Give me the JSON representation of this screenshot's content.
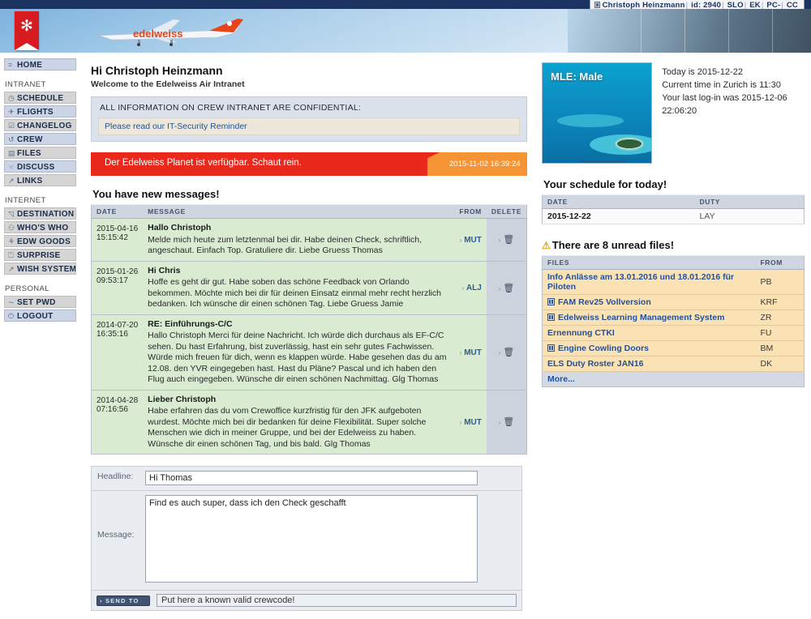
{
  "topbar": {
    "user_icon": "window-icon",
    "user_name": "Christoph Heinzmann",
    "id_label": "id: 2940",
    "slo": "SLO",
    "ek": "EK",
    "pc": "PC-",
    "cc": "CC",
    "separator": "|"
  },
  "header": {
    "logo_alt": "edelweiss-logo",
    "plane_alt": "edelweiss-aircraft"
  },
  "nav": {
    "home": {
      "label": "HOME",
      "icon": "grid-icon"
    },
    "sections": [
      {
        "title": "INTRANET",
        "items": [
          {
            "label": "SCHEDULE",
            "icon": "clock-icon",
            "glyph": "◷",
            "style": "gray"
          },
          {
            "label": "FLIGHTS",
            "icon": "plane-icon",
            "glyph": "✈",
            "style": "blue"
          },
          {
            "label": "CHANGELOG",
            "icon": "checkbox-icon",
            "glyph": "☑",
            "style": "gray"
          },
          {
            "label": "CREW",
            "icon": "refresh-icon",
            "glyph": "↺",
            "style": "blue"
          },
          {
            "label": "FILES",
            "icon": "document-icon",
            "glyph": "🗎",
            "style": "gray"
          },
          {
            "label": "DISCUSS",
            "icon": "speech-icon",
            "glyph": "♉",
            "style": "blue"
          },
          {
            "label": "LINKS",
            "icon": "external-link-icon",
            "glyph": "↗",
            "style": "gray"
          }
        ]
      },
      {
        "title": "INTERNET",
        "items": [
          {
            "label": "DESTINATION",
            "icon": "mountain-icon",
            "glyph": "⌂",
            "style": "gray"
          },
          {
            "label": "WHO'S WHO",
            "icon": "people-icon",
            "glyph": "品",
            "style": "gray"
          },
          {
            "label": "EDW GOODS",
            "icon": "person-icon",
            "glyph": "ጸ",
            "style": "gray"
          },
          {
            "label": "SURPRISE",
            "icon": "gift-icon",
            "glyph": "⊽",
            "style": "gray"
          },
          {
            "label": "WISH SYSTEM",
            "icon": "external-link-icon",
            "glyph": "↗",
            "style": "gray"
          }
        ]
      },
      {
        "title": "PERSONAL",
        "items": [
          {
            "label": "SET PWD",
            "icon": "key-icon",
            "glyph": "∼",
            "style": "gray"
          },
          {
            "label": "LOGOUT",
            "icon": "power-icon",
            "glyph": "⏻",
            "style": "blue"
          }
        ]
      }
    ]
  },
  "main": {
    "greeting": "Hi Christoph Heinzmann",
    "subgreeting": "Welcome to the Edelweiss Air Intranet",
    "confidential": {
      "title": "ALL INFORMATION ON CREW INTRANET ARE CONFIDENTIAL:",
      "link": "Please read our IT-Security Reminder"
    },
    "planet_banner": {
      "text": "Der Edelweiss Planet ist verfügbar. Schaut rein.",
      "date": "2015-11-02 16:39:24"
    },
    "messages_heading": "You have new messages!",
    "messages_columns": {
      "date": "DATE",
      "message": "MESSAGE",
      "from": "FROM",
      "delete": "DELETE"
    },
    "messages": [
      {
        "date": "2015-04-16",
        "time": "15:15:42",
        "title": "Hallo Christoph",
        "body": "Melde mich heute zum letztenmal bei dir. Habe deinen Check, schriftlich, angeschaut. Einfach Top. Gratuliere dir. Liebe Gruess Thomas",
        "from": "MUT",
        "delete_icon": "trash-icon"
      },
      {
        "date": "2015-01-26",
        "time": "09:53:17",
        "title": "Hi Chris",
        "body": "Hoffe es geht dir gut. Habe soben das schöne Feedback von Orlando bekommen. Möchte mich bei dir für deinen Einsatz einmal mehr recht herzlich bedanken. Ich wünsche dir einen schönen Tag. Liebe Gruess Jamie",
        "from": "ALJ",
        "delete_icon": "trash-icon"
      },
      {
        "date": "2014-07-20",
        "time": "16:35:16",
        "title": "RE: Einführungs-C/C",
        "body": "Hallo Christoph Merci für deine Nachricht. Ich würde dich durchaus als EF-C/C sehen. Du hast Erfahrung, bist zuverlässig, hast ein sehr gutes Fachwissen. Würde mich freuen für dich, wenn es klappen würde. Habe gesehen das du am 12.08. den YVR eingegeben hast. Hast du Pläne? Pascal und ich haben den Flug auch eingegeben. Wünsche dir einen schönen Nachmittag. Glg Thomas",
        "from": "MUT",
        "delete_icon": "trash-icon"
      },
      {
        "date": "2014-04-28",
        "time": "07:16:56",
        "title": "Lieber Christoph",
        "body": "Habe erfahren das du vom Crewoffice kurzfristig für den JFK aufgeboten wurdest. Möchte mich bei dir bedanken für deine Flexibilität. Super solche Menschen wie dich in meiner Gruppe, und bei der Edelweiss zu haben. Wünsche dir einen schönen Tag, und bis bald. Glg Thomas",
        "from": "MUT",
        "delete_icon": "trash-icon"
      }
    ],
    "compose": {
      "headline_label": "Headline:",
      "headline_value": "Hi Thomas",
      "message_label": "Message:",
      "message_value": "Find es auch super, dass ich den Check geschafft",
      "send_button": "› SEND TO",
      "crewcode_value": "Put here a known valid crewcode!"
    }
  },
  "side": {
    "destination": {
      "caption": "MLE: Male",
      "today": "Today is 2015-12-22",
      "zurich_time": "Current time in Zurich is 11:30",
      "last_login": "Your last log-in was 2015-12-06 22:06:20"
    },
    "schedule_heading": "Your schedule for today!",
    "schedule_columns": {
      "date": "DATE",
      "duty": "DUTY"
    },
    "schedule_rows": [
      {
        "date": "2015-12-22",
        "duty": "LAY"
      }
    ],
    "unread_heading": "There are 8 unread files!",
    "unread_icon": "warning-icon",
    "files_columns": {
      "files": "FILES",
      "from": "FROM"
    },
    "files": [
      {
        "name": "Info Anlässe am 13.01.2016 und 18.01.2016 für Piloten",
        "from": "PB",
        "has_icon": false
      },
      {
        "name": "FAM Rev25 Vollversion",
        "from": "KRF",
        "has_icon": true
      },
      {
        "name": "Edelweiss Learning Management System",
        "from": "ZR",
        "has_icon": true
      },
      {
        "name": "Ernennung CTKI",
        "from": "FU",
        "has_icon": false
      },
      {
        "name": "Engine Cowling Doors",
        "from": "BM",
        "has_icon": true
      },
      {
        "name": "ELS Duty Roster JAN16",
        "from": "DK",
        "has_icon": false
      }
    ],
    "more_label": "More..."
  },
  "colors": {
    "navy": "#1b3361",
    "red": "#e8291c",
    "orange": "#f49434",
    "message_green": "#d9ecd2",
    "file_amber": "#fbe2b4",
    "link_blue": "#23519a"
  }
}
